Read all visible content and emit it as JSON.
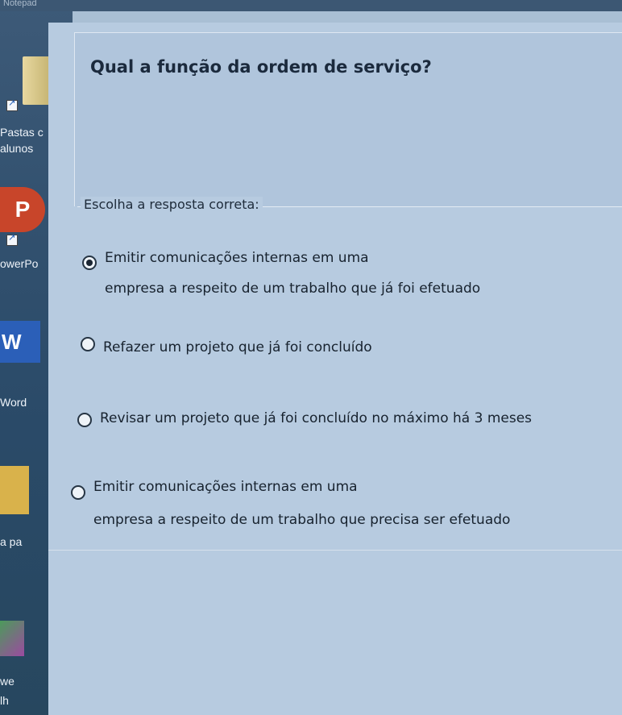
{
  "window": {
    "title_fragment": "Notepad"
  },
  "desktop": {
    "items": [
      {
        "label_line1": "Pastas c",
        "label_line2": "alunos"
      },
      {
        "label": "owerPo"
      },
      {
        "label": "Word"
      },
      {
        "label": "a pa"
      },
      {
        "label_line1": "we",
        "label_line2": "lh"
      }
    ],
    "ppt_letter": "P",
    "word_letter": "W"
  },
  "quiz": {
    "question": "Qual a função da ordem de serviço?",
    "instruction": "Escolha a resposta correta:",
    "options": [
      {
        "line1": "Emitir comunicações internas em uma",
        "line2": "empresa a respeito de um trabalho que já foi efetuado",
        "selected": true
      },
      {
        "line1": "Refazer um projeto que já foi concluído",
        "selected": false
      },
      {
        "line1": "Revisar um projeto que já foi concluído no máximo há 3 meses",
        "selected": false
      },
      {
        "line1": "Emitir comunicações internas em uma",
        "line2": "empresa a respeito de um trabalho que precisa ser efetuado",
        "selected": false
      }
    ]
  }
}
